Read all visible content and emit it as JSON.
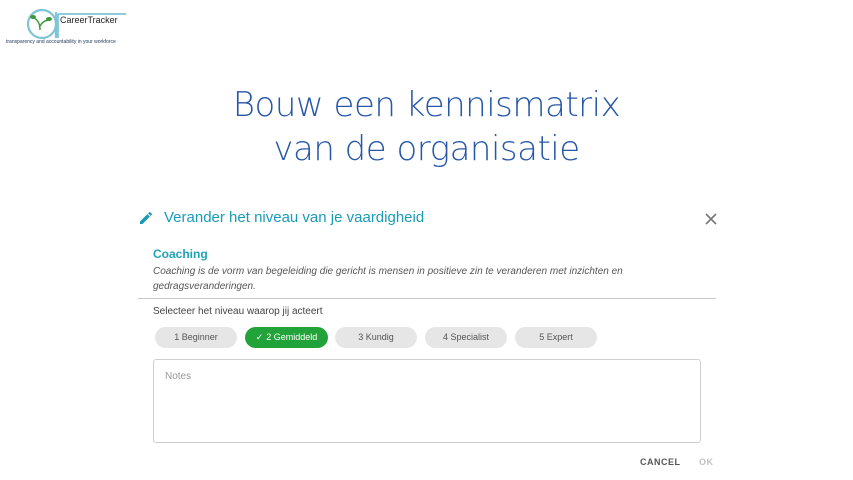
{
  "logo": {
    "name": "CareerTracker",
    "tagline": "transparency and accountability in your workforce"
  },
  "slide": {
    "title_line1": "Bouw een kennismatrix",
    "title_line2": "van de organisatie"
  },
  "dialog": {
    "title": "Verander het niveau van je vaardigheid",
    "skill": {
      "name": "Coaching",
      "description": "Coaching is de vorm van begeleiding die gericht is mensen in positieve zin te veranderen met inzichten en gedragsveranderingen."
    },
    "select_label": "Selecteer het niveau waarop jij acteert",
    "levels": [
      {
        "label": "1 Beginner"
      },
      {
        "label": "2 Gemiddeld"
      },
      {
        "label": "3 Kundig"
      },
      {
        "label": "4 Specialist"
      },
      {
        "label": "5 Expert"
      }
    ],
    "selected_level": "2 Gemiddeld",
    "notes": {
      "value": "",
      "placeholder": "Notes"
    },
    "cancel_label": "CANCEL",
    "ok_label": "OK",
    "colors": {
      "accent": "#1a9bb5",
      "selected": "#22a33a",
      "chip": "#e6e6e6",
      "title": "#2757a8"
    }
  }
}
